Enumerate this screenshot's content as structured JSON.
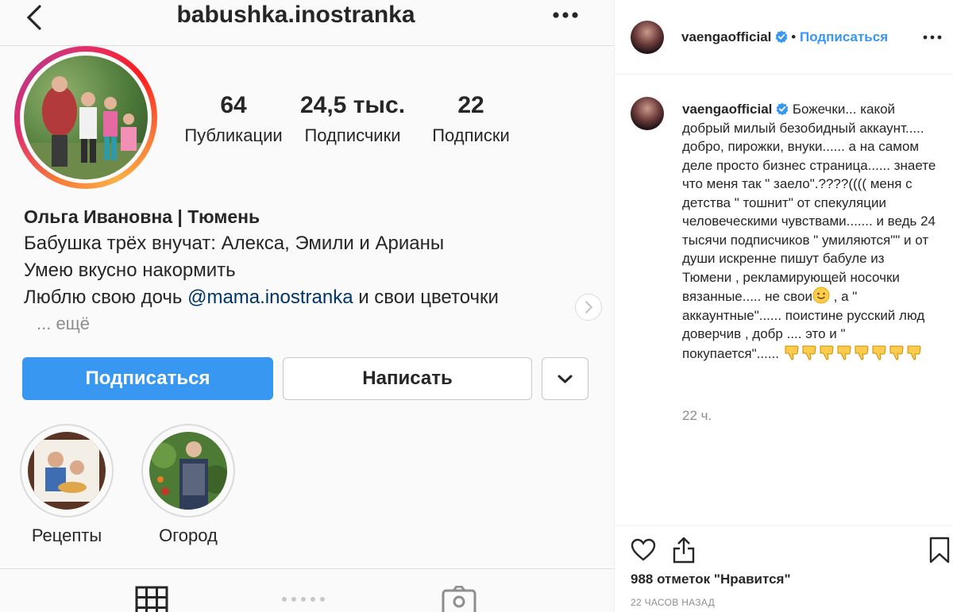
{
  "profile": {
    "username": "babushka.inostranka",
    "stats": [
      {
        "value": "64",
        "label": "Публикации"
      },
      {
        "value": "24,5 тыс.",
        "label": "Подписчики"
      },
      {
        "value": "22",
        "label": "Подписки"
      }
    ],
    "name": "Ольга Ивановна | Тюмень",
    "bio_line1": "Бабушка трёх внучат: Алекса, Эмили и Арианы",
    "bio_line2": "Умею вкусно накормить",
    "bio_line3_prefix": "Люблю свою дочь ",
    "bio_line3_mention": "@mama.inostranka",
    "bio_line3_suffix": " и свои цветочки",
    "more": "... ещё",
    "follow_label": "Подписаться",
    "message_label": "Написать",
    "highlights": [
      {
        "label": "Рецепты"
      },
      {
        "label": "Огород"
      }
    ]
  },
  "post": {
    "author": "vaengaofficial",
    "follow_label": "Подписаться",
    "comment_author": "vaengaofficial",
    "comment_part1": "Божечки... какой добрый милый безобидный аккаунт..... добро, пирожки, внуки...... а на самом деле просто бизнес страница...... знаете что меня так \" заело\".????(((( меня с детства \" тошнит\" от спекуляции человеческими чувствами....... и ведь 24 тысячи подписчиков \" умиляются\"\" и от души искренне пишут бабуле из Тюмени , рекламирующей носочки вязанные..... не свои",
    "comment_part2": " , а \" аккаунтные\"...... поистине русский люд доверчив , добр .... это и \" покупается\"...... ",
    "comment_time": "22 ч.",
    "likes": "988 отметок \"Нравится\"",
    "time": "22 ЧАСОВ НАЗАД"
  },
  "icons": {
    "back": "chevron-left-icon",
    "more": "more-horizontal-icon",
    "verified": "verified-badge-icon",
    "heart": "heart-icon",
    "share": "share-icon",
    "bookmark": "bookmark-icon",
    "grid": "grid-icon",
    "tagged": "tagged-icon",
    "thumbs_down": "thumbs-down-emoji",
    "smile": "smile-emoji"
  },
  "colors": {
    "accent": "#3897f0",
    "mention": "#003569",
    "muted": "#8e8e8e"
  }
}
